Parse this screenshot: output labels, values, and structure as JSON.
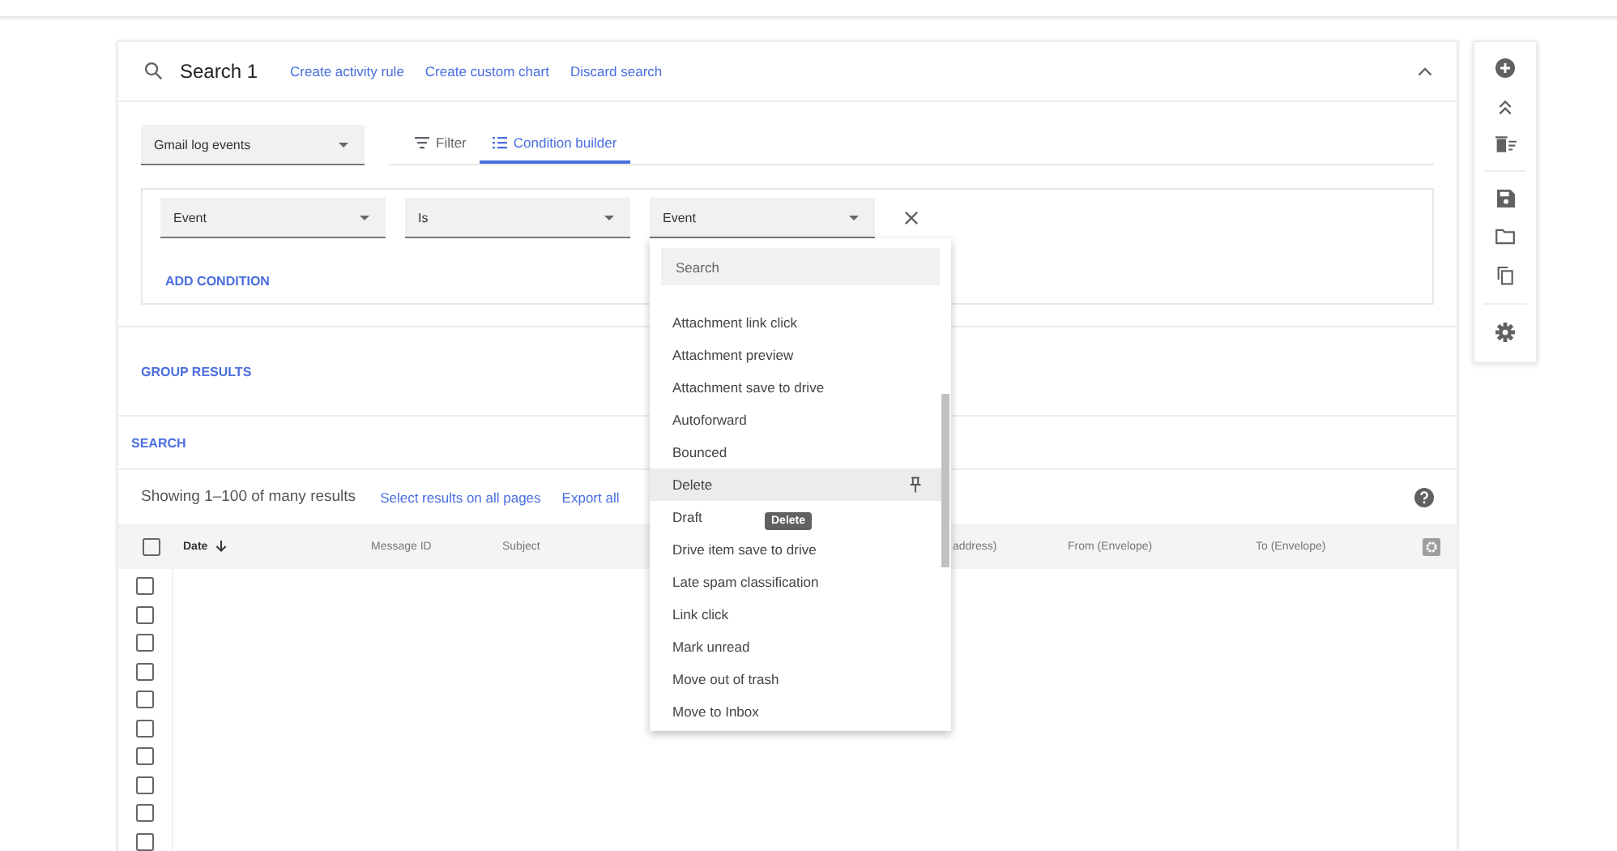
{
  "search": {
    "title": "Search 1",
    "links": [
      "Create activity rule",
      "Create custom chart",
      "Discard search"
    ],
    "expanded": true
  },
  "source_select": {
    "value": "Gmail log events"
  },
  "tabs": [
    {
      "label": "Filter",
      "selected": false
    },
    {
      "label": "Condition builder",
      "selected": true
    }
  ],
  "condition": {
    "fields": [
      {
        "value": "Event"
      },
      {
        "value": "Is"
      },
      {
        "value": "Event"
      }
    ],
    "add_label": "ADD CONDITION"
  },
  "menu": {
    "placeholder": "Search",
    "tooltip": "Delete",
    "items": [
      {
        "label": "Attachment link click",
        "selected": false
      },
      {
        "label": "Attachment preview",
        "selected": false
      },
      {
        "label": "Attachment save to drive",
        "selected": false
      },
      {
        "label": "Autoforward",
        "selected": false
      },
      {
        "label": "Bounced",
        "selected": false
      },
      {
        "label": "Delete",
        "selected": true
      },
      {
        "label": "Draft",
        "selected": false
      },
      {
        "label": "Drive item save to drive",
        "selected": false
      },
      {
        "label": "Late spam classification",
        "selected": false
      },
      {
        "label": "Link click",
        "selected": false
      },
      {
        "label": "Mark unread",
        "selected": false
      },
      {
        "label": "Move out of trash",
        "selected": false
      },
      {
        "label": "Move to Inbox",
        "selected": false
      }
    ]
  },
  "group_results": "GROUP RESULTS",
  "search_button": "SEARCH",
  "results": {
    "summary": "Showing 1–100 of many results",
    "links": [
      "Select results on all pages",
      "Export all"
    ]
  },
  "table": {
    "header_checked": false,
    "columns": [
      {
        "label": "Date",
        "sorted": true
      },
      {
        "label": "Message ID",
        "sorted": false
      },
      {
        "label": "Subject",
        "sorted": false
      },
      {
        "label": "address)",
        "sorted": false
      },
      {
        "label": "From (Envelope)",
        "sorted": false
      },
      {
        "label": "To (Envelope)",
        "sorted": false
      }
    ],
    "rows": [
      {
        "checked": false
      },
      {
        "checked": false
      },
      {
        "checked": false
      },
      {
        "checked": false
      },
      {
        "checked": false
      },
      {
        "checked": false
      },
      {
        "checked": false
      },
      {
        "checked": false
      },
      {
        "checked": false
      },
      {
        "checked": false
      }
    ]
  }
}
